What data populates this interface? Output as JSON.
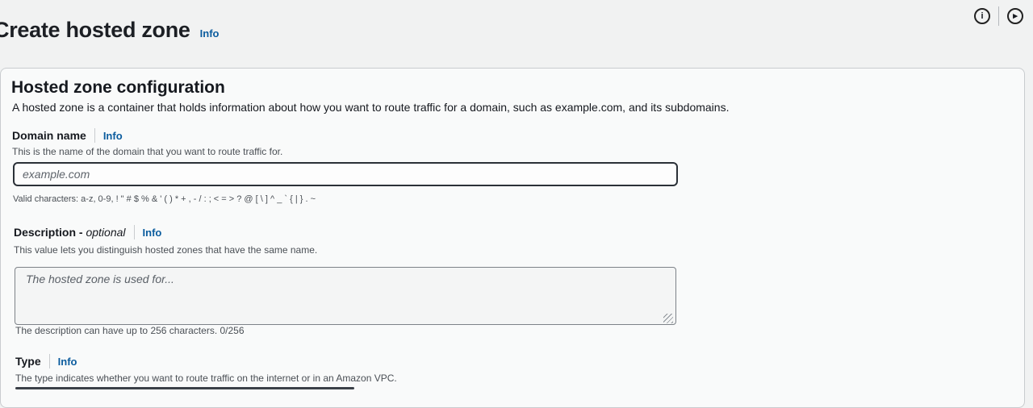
{
  "header": {
    "title": "Create hosted zone",
    "info_label": "Info"
  },
  "top_icons": [
    "info-circle-icon",
    "feedback-circle-icon"
  ],
  "panel": {
    "title": "Hosted zone configuration",
    "description": "A hosted zone is a container that holds information about how you want to route traffic for a domain, such as example.com, and its subdomains.",
    "domain": {
      "label": "Domain name",
      "info": "Info",
      "hint": "This is the name of the domain that you want to route traffic for.",
      "placeholder": "example.com",
      "constraint": "Valid characters: a-z, 0-9, ! \" # $ % & ' ( ) * + , - / : ; < = > ? @ [ \\ ] ^ _ ` { | } . ~"
    },
    "description_field": {
      "label": "Description - ",
      "optional": "optional",
      "info": "Info",
      "hint": "This value lets you distinguish hosted zones that have the same name.",
      "placeholder": "The hosted zone is used for...",
      "constraint": "The description can have up to 256 characters. 0/256"
    },
    "type": {
      "label": "Type",
      "info": "Info",
      "hint": "The type indicates whether you want to route traffic on the internet or in an Amazon VPC."
    }
  },
  "colors": {
    "link": "#0b5c9e",
    "text": "#16191f",
    "background": "#f1f2f2"
  }
}
